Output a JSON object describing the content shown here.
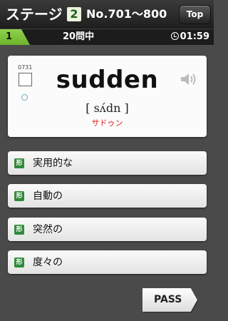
{
  "header": {
    "title": "ステージ",
    "stage_number": "2",
    "range": "No.701〜800",
    "top_button": "Top"
  },
  "progress": {
    "question_number": "1",
    "question_count": "20問中",
    "timer": "01:59"
  },
  "card": {
    "word_id": "0731",
    "word": "sudden",
    "phonetic": "[ sʌ́dn ]",
    "katakana": "サドゥン",
    "speaker_icon": "speaker-icon"
  },
  "options": [
    {
      "badge": "形",
      "label": "実用的な"
    },
    {
      "badge": "形",
      "label": "自動の"
    },
    {
      "badge": "形",
      "label": "突然の"
    },
    {
      "badge": "形",
      "label": "度々の"
    }
  ],
  "pass_button": "PASS",
  "colors": {
    "accent_green": "#6cb42a",
    "badge_green": "#2f8a3a",
    "katakana_red": "#e02020"
  }
}
